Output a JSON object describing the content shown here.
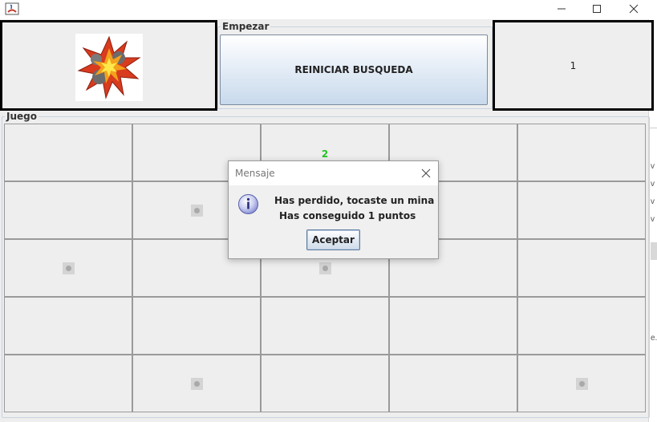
{
  "window": {
    "minimize_icon": "minimize-icon",
    "maximize_icon": "maximize-icon",
    "close_icon": "close-icon"
  },
  "top": {
    "empezar_group_title": "Empezar",
    "reset_button_label": "REINICIAR BUSQUEDA",
    "score_display": "1",
    "status_image": "explosion-icon"
  },
  "game": {
    "group_title": "Juego",
    "cells": [
      [
        "",
        "",
        "2",
        "",
        ""
      ],
      [
        "",
        "mine",
        "",
        "",
        ""
      ],
      [
        "mine",
        "",
        "mine",
        "",
        ""
      ],
      [
        "",
        "",
        "",
        "",
        ""
      ],
      [
        "",
        "mine",
        "",
        "",
        "mine"
      ]
    ]
  },
  "dialog": {
    "title": "Mensaje",
    "line1": "Has perdido, tocaste un mina",
    "line2": "Has conseguido 1 puntos",
    "ok_label": "Aceptar",
    "icon": "info-icon"
  },
  "background_window": {
    "edge_chars": [
      "v",
      "v",
      "v",
      "v",
      "e."
    ]
  },
  "colors": {
    "number_green": "#22c422",
    "panel_border": "#000000",
    "button_gradient_bottom": "#c8d9ec"
  }
}
